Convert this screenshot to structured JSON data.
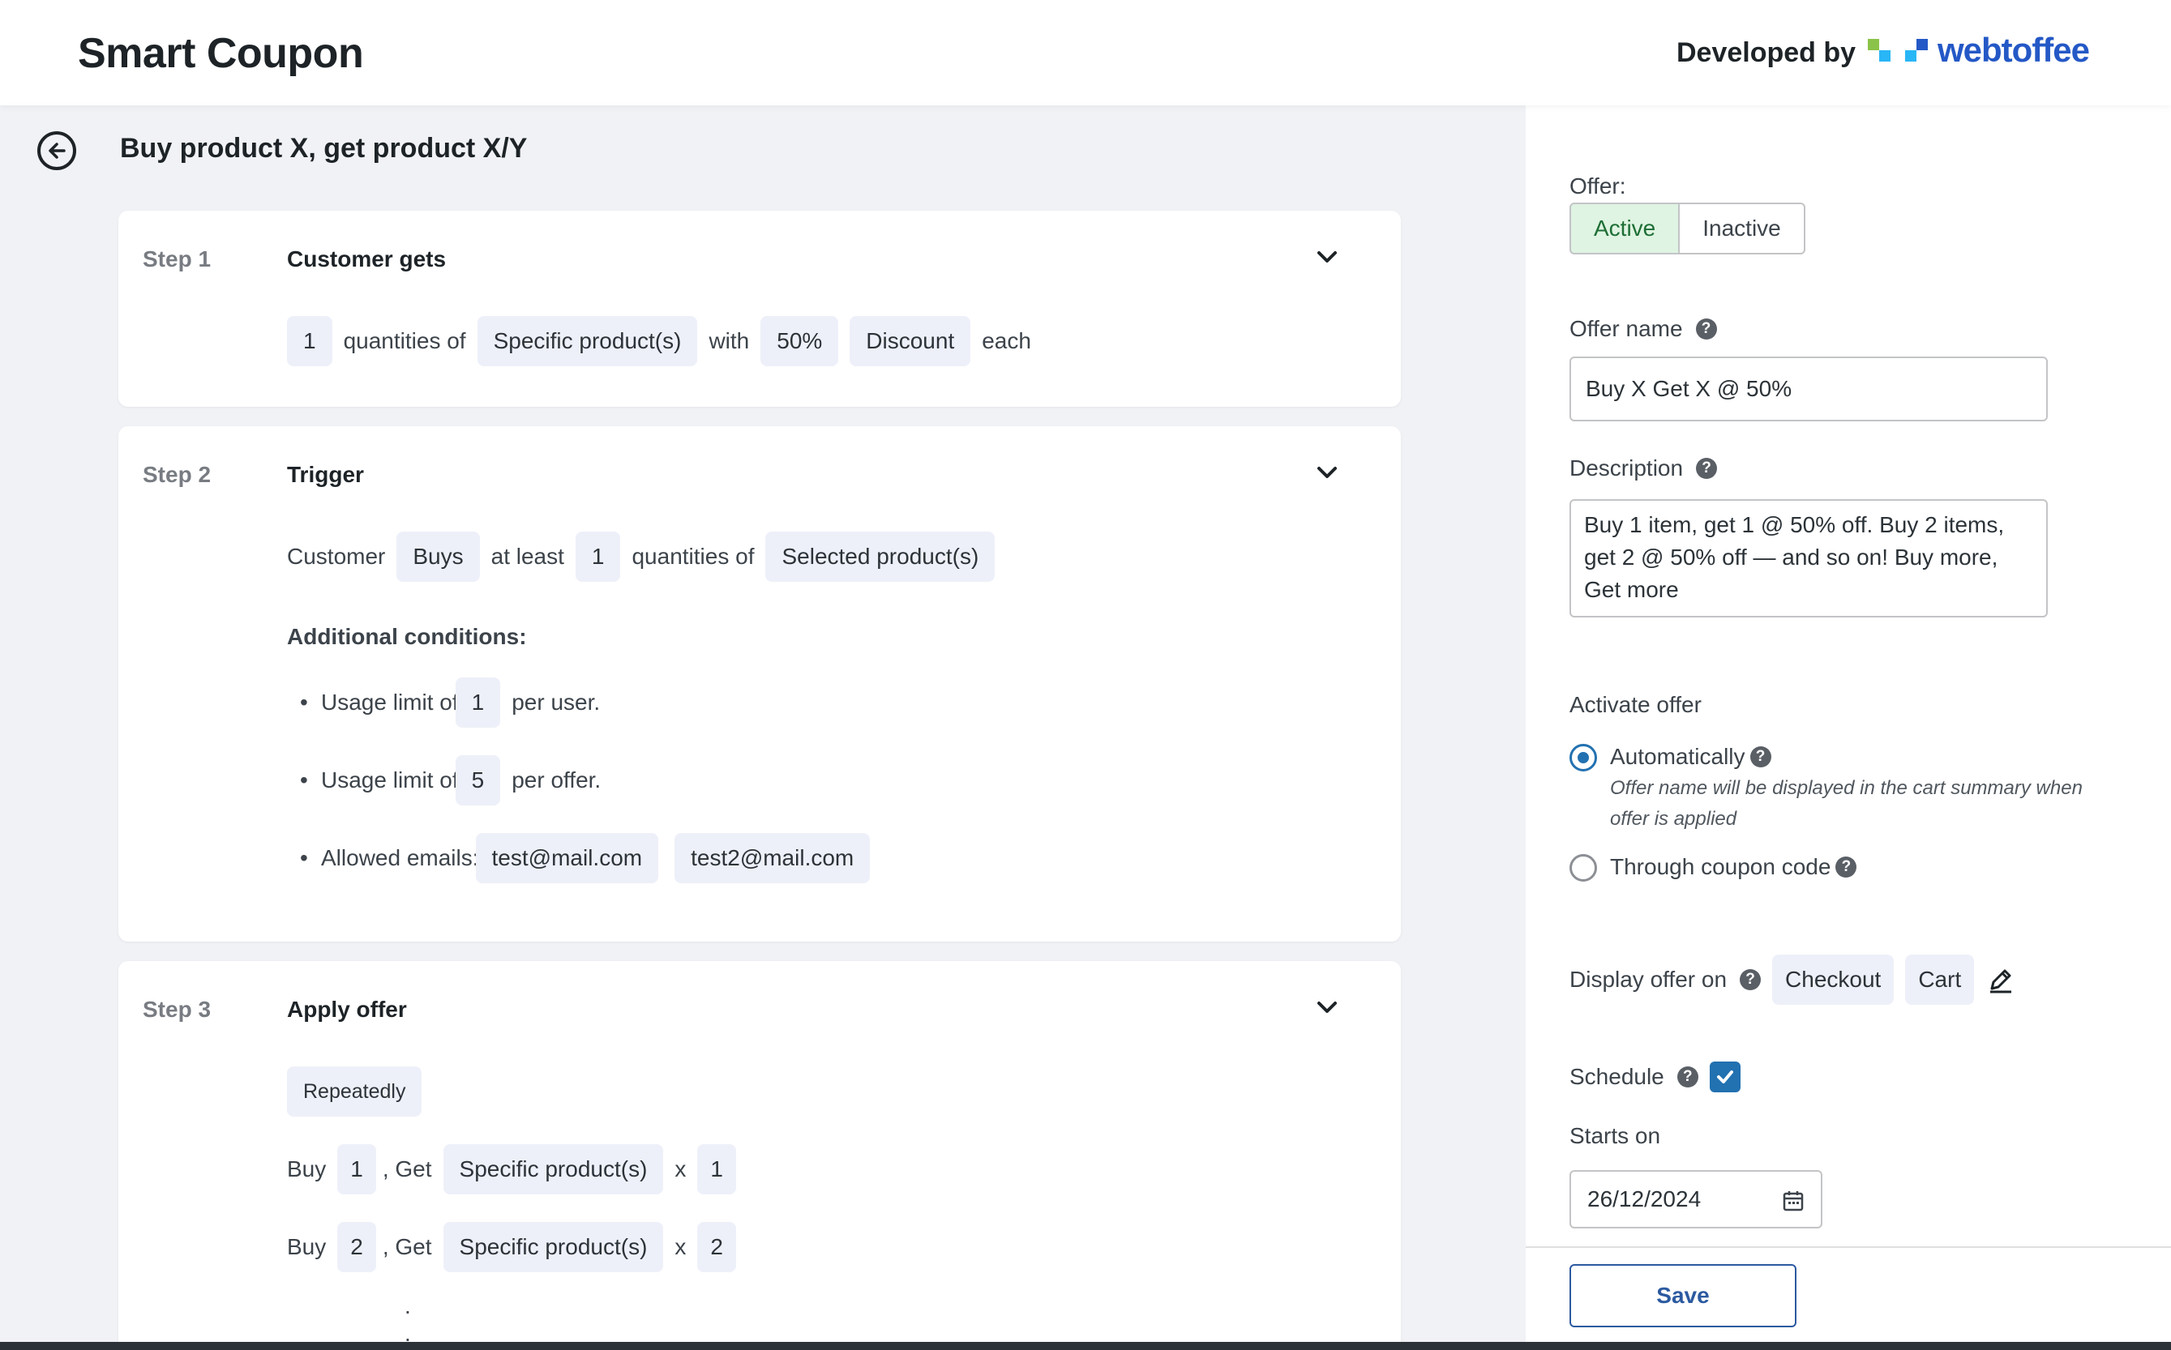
{
  "header": {
    "app_title": "Smart Coupon",
    "developed_by": "Developed by",
    "brand_name": "webtoffee",
    "brand_colors": [
      "#8bc34a",
      "#29b6f6",
      "#2458c6"
    ]
  },
  "page": {
    "heading": "Buy product X, get product X/Y"
  },
  "steps": [
    {
      "label": "Step 1",
      "title": "Customer gets",
      "row": {
        "qty": "1",
        "t1": "quantities of",
        "product": "Specific product(s)",
        "t2": "with",
        "amount": "50%",
        "type": "Discount",
        "t3": "each"
      }
    },
    {
      "label": "Step 2",
      "title": "Trigger",
      "row": {
        "t1": "Customer",
        "action": "Buys",
        "t2": "at least",
        "qty": "1",
        "t3": "quantities of",
        "product": "Selected product(s)"
      },
      "conditions_title": "Additional conditions:",
      "conditions": [
        {
          "prefix": "Usage limit of",
          "value": "1",
          "suffix": "per user."
        },
        {
          "prefix": "Usage limit of",
          "value": "5",
          "suffix": "per offer."
        },
        {
          "prefix": "Allowed emails:",
          "emails": [
            "test@mail.com",
            "test2@mail.com"
          ]
        }
      ]
    },
    {
      "label": "Step 3",
      "title": "Apply offer",
      "mode": "Repeatedly",
      "rules": [
        {
          "buy": "Buy",
          "buy_qty": "1",
          "get": ", Get",
          "product": "Specific product(s)",
          "x": "x",
          "get_qty": "1"
        },
        {
          "buy": "Buy",
          "buy_qty": "2",
          "get": ", Get",
          "product": "Specific product(s)",
          "x": "x",
          "get_qty": "2"
        }
      ],
      "ellipsis": [
        ".",
        "."
      ]
    }
  ],
  "sidebar": {
    "offer_label": "Offer:",
    "offer_active": "Active",
    "offer_inactive": "Inactive",
    "offer_name_label": "Offer name",
    "offer_name_value": "Buy X Get X @ 50%",
    "description_label": "Description",
    "description_value": "Buy 1 item, get 1 @ 50% off. Buy 2 items, get 2 @ 50% off — and so on! Buy more, Get more",
    "activate_label": "Activate offer",
    "auto_label": "Automatically",
    "auto_hint": "Offer name will be displayed in the cart summary when offer is applied",
    "coupon_label": "Through coupon code",
    "display_label": "Display offer on",
    "display_pills": [
      "Checkout",
      "Cart"
    ],
    "schedule_label": "Schedule",
    "schedule_checked": true,
    "starts_label": "Starts on",
    "starts_value": "26/12/2024",
    "save_label": "Save",
    "help_glyph": "?"
  }
}
